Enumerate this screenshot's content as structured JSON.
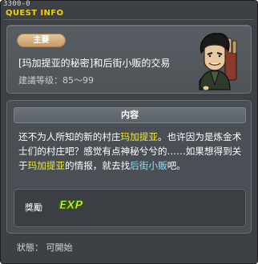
{
  "window": {
    "quest_id": "3300-0",
    "title": "QUEST INFO"
  },
  "quest": {
    "category_badge": "主要",
    "name": "[玛加提亚的秘密]和后街小贩的交易",
    "level": "建議等级：85～99"
  },
  "content": {
    "header": "内容",
    "description": [
      {
        "text": "还不为人所知的新的村庄",
        "style": "normal"
      },
      {
        "text": "玛加提亚",
        "style": "yellow"
      },
      {
        "text": "。也许因为是炼金术士们的村庄吧？感觉有点神秘兮兮的……如果想得到关于",
        "style": "normal"
      },
      {
        "text": "玛加提亚",
        "style": "yellow"
      },
      {
        "text": "的情报，就去找",
        "style": "normal"
      },
      {
        "text": "后街小贩",
        "style": "cyan"
      },
      {
        "text": "吧。",
        "style": "normal"
      }
    ]
  },
  "reward": {
    "label": "獎勵",
    "exp_icon_text": "EXP"
  },
  "status": {
    "text": "狀態： 可開始"
  },
  "colors": {
    "title": "#f5d000",
    "highlight_place": "#f2ec2c",
    "highlight_npc": "#8de0f6",
    "badge": "#c49a68"
  },
  "icons": {
    "npc_portrait": "back-street-vendor-portrait",
    "reward_type": "exp-icon"
  }
}
